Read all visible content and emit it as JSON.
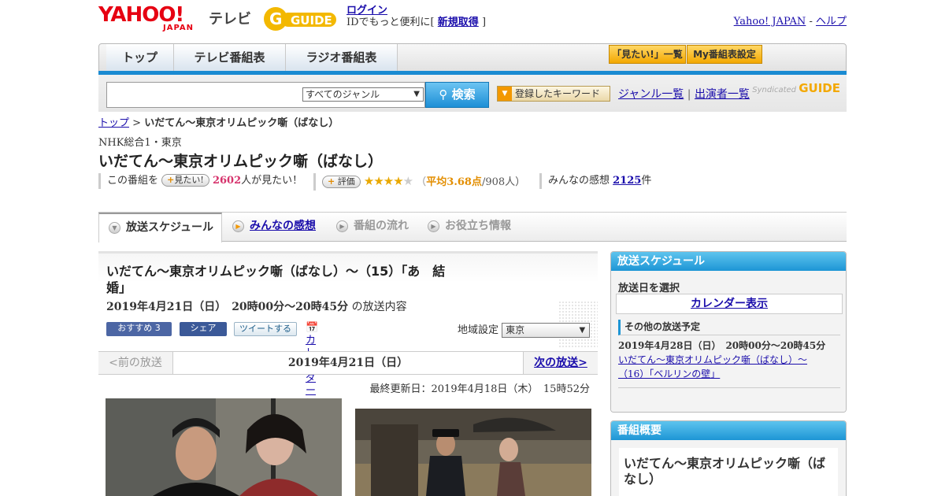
{
  "header": {
    "logo_text": "YAHOO!",
    "logo_sub": "JAPAN",
    "service": "テレビ",
    "gguide": "GUIDE",
    "login_link": "ログイン",
    "login_text": "IDでもっと便利に[",
    "signup_link": "新規取得",
    "bracket_close": "]",
    "yahoo_japan": "Yahoo! JAPAN",
    "separator": "-",
    "help": "ヘルプ"
  },
  "nav": {
    "tabs": [
      {
        "label": "トップ"
      },
      {
        "label": "テレビ番組表"
      },
      {
        "label": "ラジオ番組表"
      }
    ],
    "want_list": "「見たい!」一覧",
    "my_schedule": "My番組表設定"
  },
  "search": {
    "placeholder": "",
    "genre": "すべてのジャンル",
    "button": "検索",
    "keyword": "登録したキーワード",
    "genre_list": "ジャンル一覧",
    "sep": "|",
    "performers": "出演者一覧",
    "syndicated": "Syndicated"
  },
  "breadcrumb": {
    "top": "トップ",
    "sep": ">",
    "current": "いだてん～東京オリムピック噺（ばなし）"
  },
  "program": {
    "channel": "NHK総合1・東京",
    "title": "いだてん～東京オリムピック噺（ばなし）",
    "want_pre": "この番組を",
    "want_btn": "見たい!",
    "want_count": "2602",
    "want_post": "人が見たい！",
    "rate_btn": "評価",
    "rating": 3.68,
    "rating_open": "（",
    "rating_label": "平均3.68点",
    "rating_votes": "/908人）",
    "review_pre": "みんなの感想",
    "review_count": "2125",
    "review_post": "件"
  },
  "tabs": [
    {
      "label": "放送スケジュール"
    },
    {
      "label": "みんなの感想"
    },
    {
      "label": "番組の流れ"
    },
    {
      "label": "お役立ち情報"
    }
  ],
  "episode": {
    "title": "いだてん～東京オリムピック噺（ばなし）～（15）「あ　結婚」",
    "date": "2019年4月21日（日）　20時00分～20時45分",
    "date_suffix": "の放送内容",
    "fb_recommend": "おすすめ 3",
    "fb_share": "シェア",
    "tweet": "ツイートする",
    "calendar": "カレンダーに登録",
    "region_label": "地域設定",
    "region": "東京",
    "prev": "<前の放送",
    "current": "2019年4月21日（日）",
    "next": "次の放送>",
    "updated": "最終更新日：2019年4月18日（木）　15時52分"
  },
  "sidebar": {
    "schedule_title": "放送スケジュール",
    "select_date": "放送日を選択",
    "calendar": "カレンダー表示",
    "other": "その他の放送予定",
    "other_date": "2019年4月28日（日）　20時00分～20時45分",
    "other_link": "いだてん～東京オリムピック噺（ばなし）～（16）「ベルリンの壁」",
    "overview_title": "番組概要",
    "overview_name": "いだてん～東京オリムピック噺（ばなし）"
  },
  "colors": {
    "accent": "#1a8bd2",
    "link": "#1a0dab",
    "yahoo": "#e60012",
    "want": "#d6336c"
  }
}
